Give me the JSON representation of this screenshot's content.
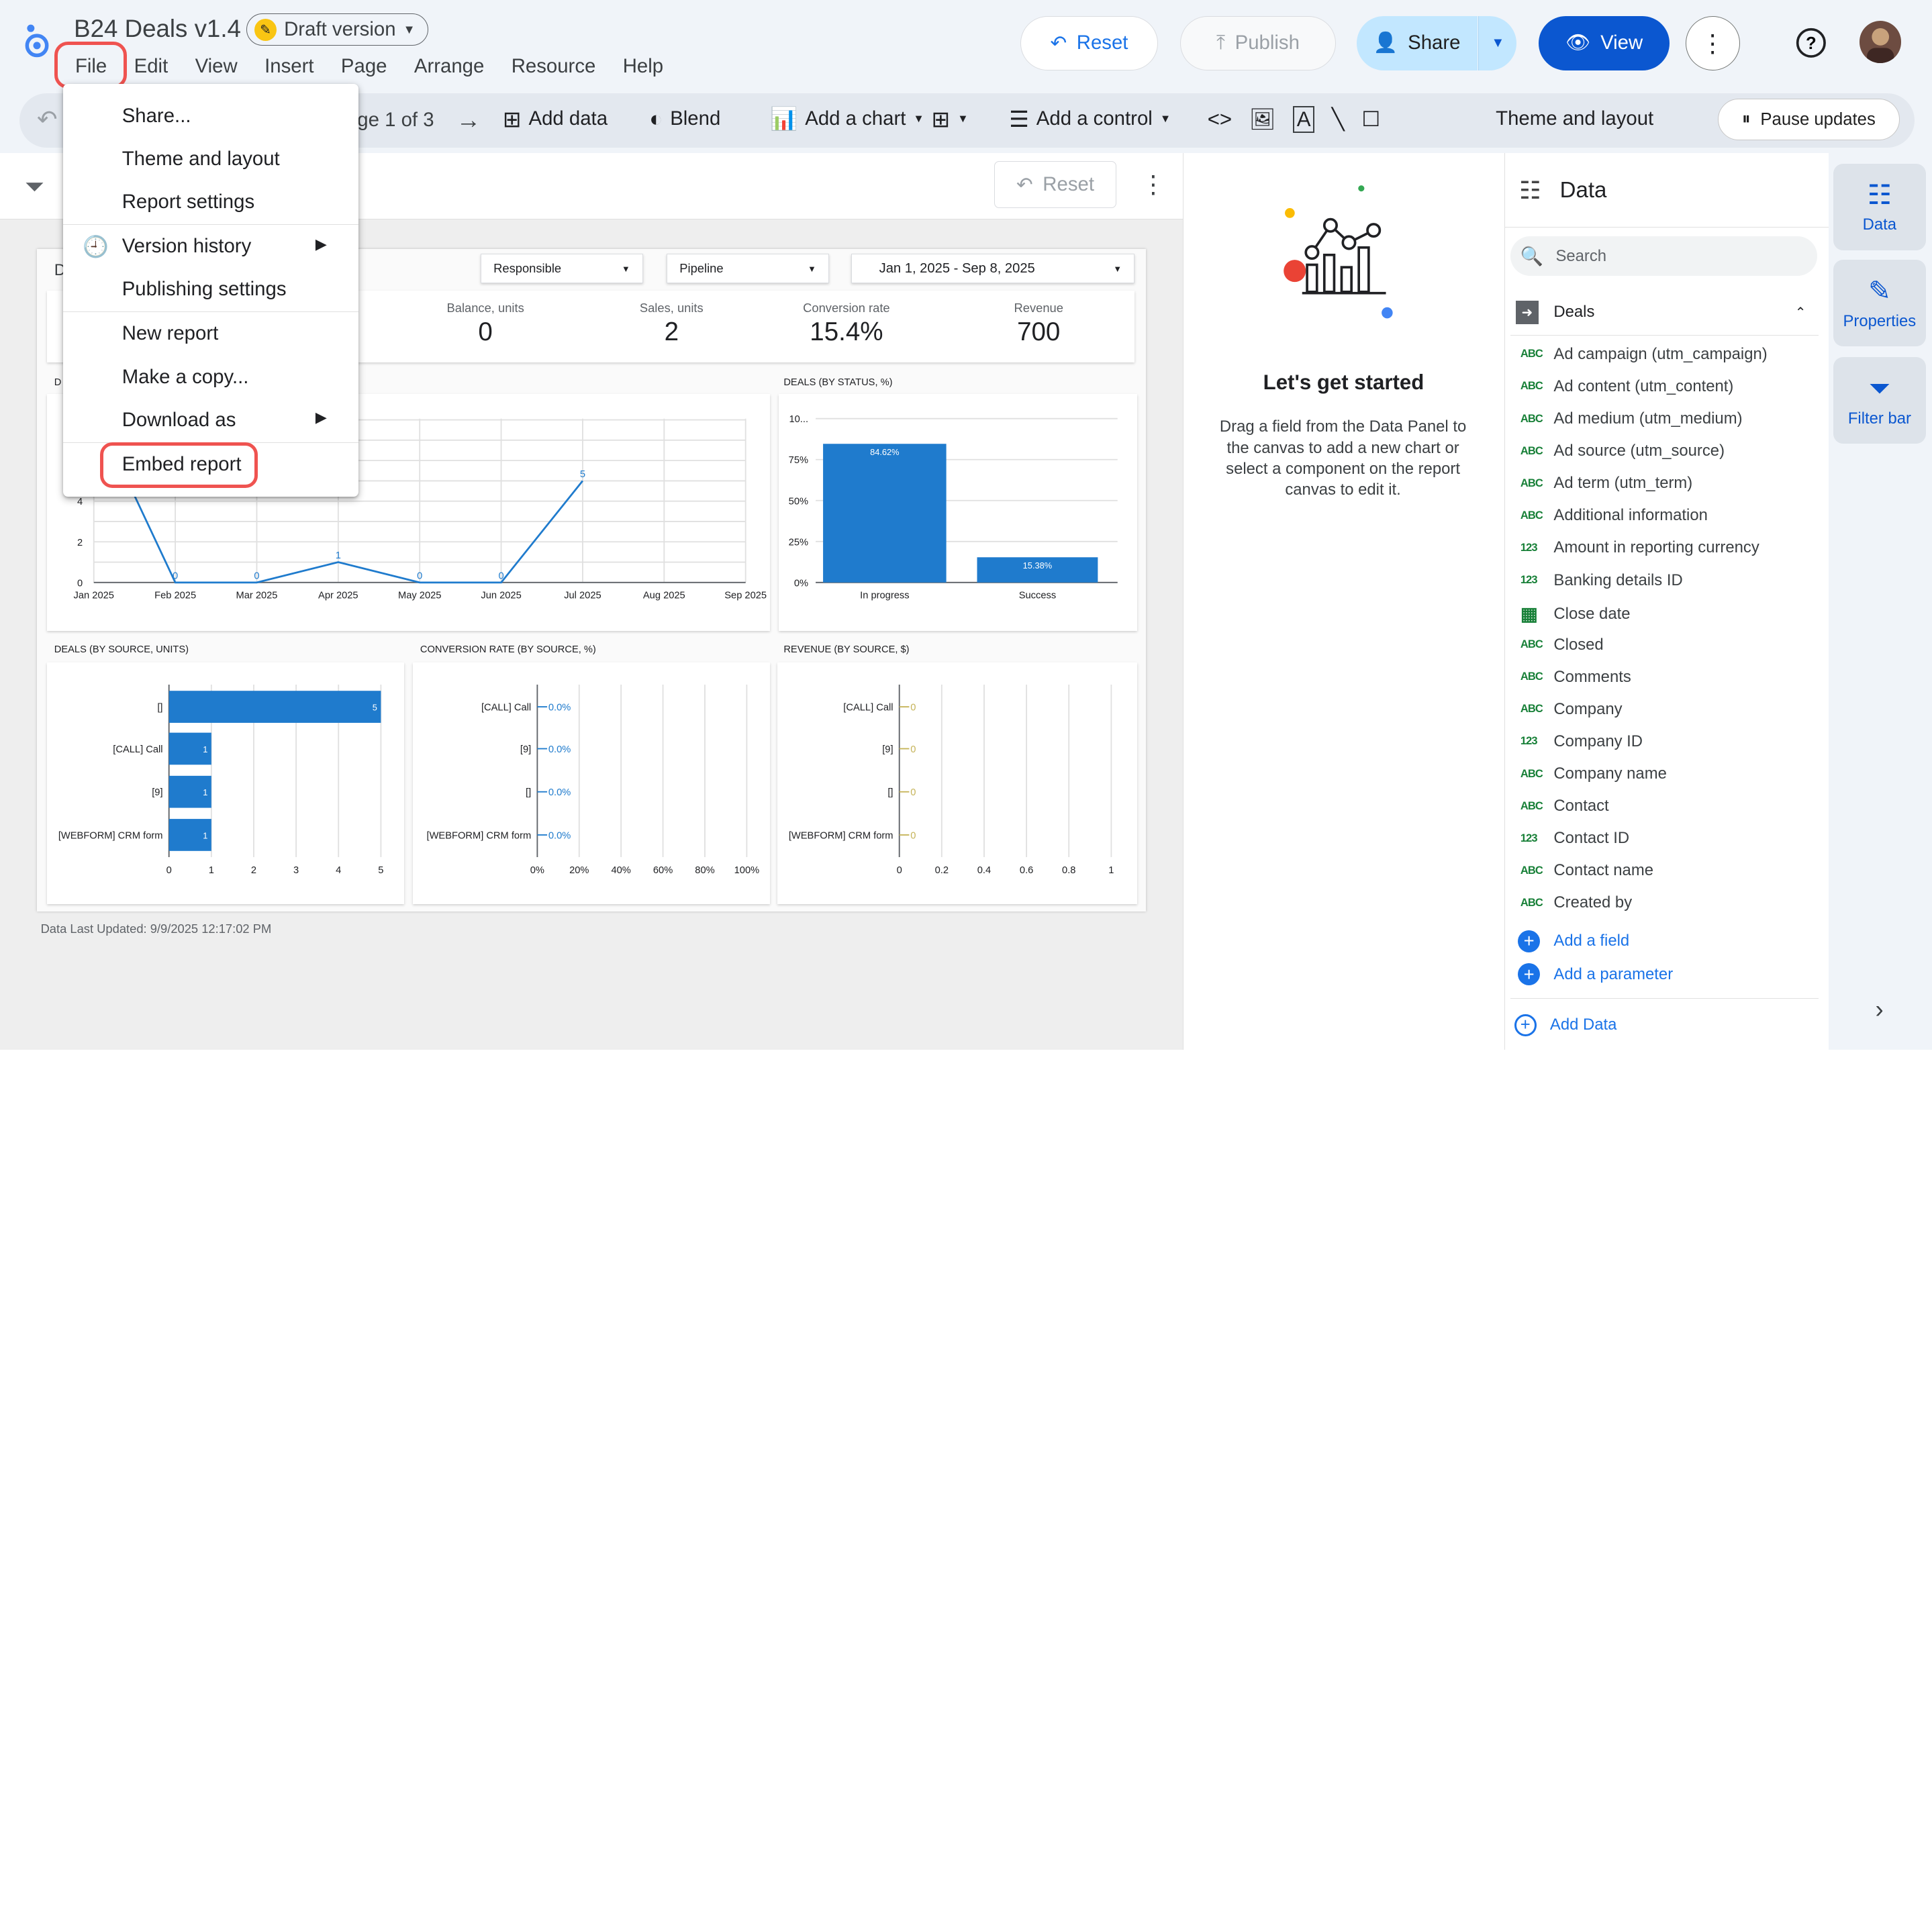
{
  "app": {
    "title": "B24 Deals v1.4",
    "draft_label": "Draft version"
  },
  "menubar": [
    "File",
    "Edit",
    "View",
    "Insert",
    "Page",
    "Arrange",
    "Resource",
    "Help"
  ],
  "header_buttons": {
    "reset": "Reset",
    "publish": "Publish",
    "share": "Share",
    "view": "View"
  },
  "toolbar": {
    "page": "ge 1 of 3",
    "add_data": "Add data",
    "blend": "Blend",
    "add_chart": "Add a chart",
    "add_control": "Add a control",
    "theme": "Theme and layout",
    "pause": "Pause updates"
  },
  "canvas": {
    "reset": "Reset",
    "report_title_fragment": "D",
    "data_updated": "Data Last Updated: 9/9/2025 12:17:02 PM"
  },
  "controls": {
    "responsible": "Responsible",
    "pipeline": "Pipeline",
    "date_range": "Jan 1, 2025 - Sep 8, 2025"
  },
  "metrics": [
    {
      "label": "Balance, units",
      "value": "0"
    },
    {
      "label": "Sales, units",
      "value": "2"
    },
    {
      "label": "Conversion rate",
      "value": "15.4%"
    },
    {
      "label": "Revenue",
      "value": "700"
    }
  ],
  "file_menu": {
    "items": [
      "Share...",
      "Theme and layout",
      "Report settings",
      "Version history",
      "Publishing settings",
      "New report",
      "Make a copy...",
      "Download as",
      "Embed report"
    ]
  },
  "empty_panel": {
    "heading": "Let's get started",
    "body": "Drag a field from the Data Panel to the canvas to add a new chart or select a component on the report canvas to edit it."
  },
  "data_panel": {
    "title": "Data",
    "search_placeholder": "Search",
    "source": "Deals",
    "fields": [
      {
        "type": "ABC",
        "name": "Ad campaign (utm_campaign)"
      },
      {
        "type": "ABC",
        "name": "Ad content (utm_content)"
      },
      {
        "type": "ABC",
        "name": "Ad medium (utm_medium)"
      },
      {
        "type": "ABC",
        "name": "Ad source (utm_source)"
      },
      {
        "type": "ABC",
        "name": "Ad term (utm_term)"
      },
      {
        "type": "ABC",
        "name": "Additional information"
      },
      {
        "type": "123",
        "name": "Amount in reporting currency"
      },
      {
        "type": "123",
        "name": "Banking details ID"
      },
      {
        "type": "DATE",
        "name": "Close date"
      },
      {
        "type": "ABC",
        "name": "Closed"
      },
      {
        "type": "ABC",
        "name": "Comments"
      },
      {
        "type": "ABC",
        "name": "Company"
      },
      {
        "type": "123",
        "name": "Company ID"
      },
      {
        "type": "ABC",
        "name": "Company name"
      },
      {
        "type": "ABC",
        "name": "Contact"
      },
      {
        "type": "123",
        "name": "Contact ID"
      },
      {
        "type": "ABC",
        "name": "Contact name"
      },
      {
        "type": "ABC",
        "name": "Created by"
      }
    ],
    "add_field": "Add a field",
    "add_parameter": "Add a parameter",
    "add_data": "Add Data"
  },
  "rail": {
    "data": "Data",
    "properties": "Properties",
    "filter_bar": "Filter bar"
  },
  "colors": {
    "accent": "#1a73e8",
    "bar": "#1f7bcd",
    "highlight": "#ef5350"
  },
  "chart_data": [
    {
      "type": "line",
      "title": "",
      "x": [
        "Jan 2025",
        "Feb 2025",
        "Mar 2025",
        "Apr 2025",
        "May 2025",
        "Jun 2025",
        "Jul 2025",
        "Aug 2025",
        "Sep 2025"
      ],
      "point_labels": [
        "",
        "0",
        "0",
        "1",
        "0",
        "0",
        "5",
        "",
        ""
      ],
      "yticks": [
        "0",
        "2",
        "4"
      ],
      "series": [
        {
          "values": [
            null,
            0,
            0,
            1,
            0,
            0,
            5,
            null,
            null
          ]
        }
      ]
    },
    {
      "type": "bar",
      "title": "DEALS (BY STATUS, %)",
      "categories": [
        "In progress",
        "Success"
      ],
      "values": [
        84.62,
        15.38
      ],
      "data_labels": [
        "84.62%",
        "15.38%"
      ],
      "yticks": [
        "0%",
        "25%",
        "50%",
        "75%",
        "10..."
      ]
    },
    {
      "type": "bar",
      "title": "DEALS (BY SOURCE, UNITS)",
      "orientation": "horizontal",
      "categories": [
        "[]",
        "[CALL] Call",
        "[9]",
        "[WEBFORM] CRM form"
      ],
      "values": [
        5,
        1,
        1,
        1
      ],
      "xticks": [
        "0",
        "1",
        "2",
        "3",
        "4",
        "5"
      ]
    },
    {
      "type": "bar",
      "title": "CONVERSION RATE (BY SOURCE, %)",
      "orientation": "horizontal",
      "categories": [
        "[CALL] Call",
        "[9]",
        "[]",
        "[WEBFORM] CRM form"
      ],
      "values": [
        0,
        0,
        0,
        0
      ],
      "data_labels": [
        "0.0%",
        "0.0%",
        "0.0%",
        "0.0%"
      ],
      "xticks": [
        "0%",
        "20%",
        "40%",
        "60%",
        "80%",
        "100%"
      ]
    },
    {
      "type": "bar",
      "title": "REVENUE (BY SOURCE, $)",
      "orientation": "horizontal",
      "categories": [
        "[CALL] Call",
        "[9]",
        "[]",
        "[WEBFORM] CRM form"
      ],
      "values": [
        0,
        0,
        0,
        0
      ],
      "data_labels": [
        "0",
        "0",
        "0",
        "0"
      ],
      "xticks": [
        "0",
        "0.2",
        "0.4",
        "0.6",
        "0.8",
        "1"
      ]
    }
  ]
}
